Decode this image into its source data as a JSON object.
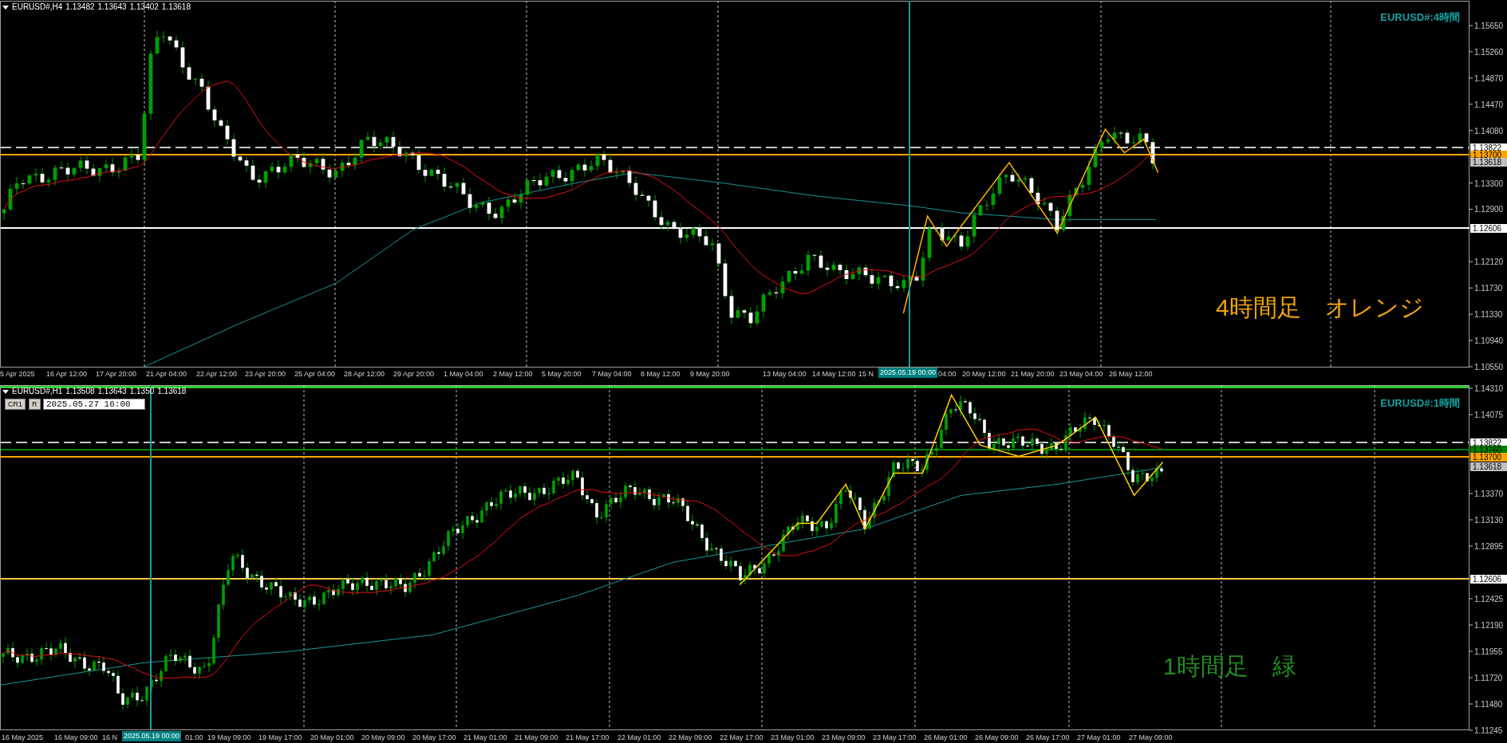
{
  "charts": [
    {
      "header": {
        "symbol": "EURUSD#,H4",
        "ohlc": [
          "1.13482",
          "1.13643",
          "1.13402",
          "1.13618"
        ]
      },
      "title": "EURUSD#:4時間",
      "note": {
        "text": "4時間足　オレンジ",
        "color": "#f0a30a"
      },
      "price_axis": [
        "1.15650",
        "1.15260",
        "1.14870",
        "1.14470",
        "1.14080",
        "1.13300",
        "1.12900",
        "1.12120",
        "1.11730",
        "1.11330",
        "1.10940",
        "1.10550"
      ],
      "price_lines": [
        {
          "kind": "dashed",
          "color": "#c8c8c8"
        },
        {
          "kind": "solid",
          "color": "#ffa500"
        },
        {
          "kind": "solid",
          "color": "#ffffff"
        }
      ],
      "price_tags": [
        {
          "text": "1.13822",
          "color": "#ffffff"
        },
        {
          "text": "1.13700",
          "color": "#ffa500"
        },
        {
          "text": "1.13618",
          "color": "#c0c0c0"
        },
        {
          "text": "1.12606",
          "color": "#ffffff"
        }
      ],
      "time_axis": [
        "5 Apr 2025",
        "16 Apr 12:00",
        "17 Apr 20:00",
        "21 Apr 04:00",
        "22 Apr 12:00",
        "23 Apr 20:00",
        "25 Apr 04:00",
        "28 Apr 12:00",
        "29 Apr 20:00",
        "1 May 04:00",
        "2 May 12:00",
        "5 May 20:00",
        "7 May 04:00",
        "8 May 12:00",
        "9 May 20:00",
        "13 May 04:00",
        "14 May 12:00",
        "15 N",
        "04:00",
        "20 May 12:00",
        "21 May 20:00",
        "23 May 04:00",
        "26 May 12:00"
      ],
      "time_cursor": "2025.05.19 00:00"
    },
    {
      "header": {
        "symbol": "EURUSD#,H1",
        "ohlc": [
          "1.13508",
          "1.13643",
          "1.1350",
          "1.13618"
        ]
      },
      "toolbar": {
        "buttons": [
          "CR1",
          "R"
        ],
        "date_field": "2025.05.27 16:00"
      },
      "title": "EURUSD#:1時間",
      "note": {
        "text": "1時間足　緑",
        "color": "#228b22"
      },
      "price_axis": [
        "1.14310",
        "1.14075",
        "1.13370",
        "1.13130",
        "1.12895",
        "1.12425",
        "1.12190",
        "1.11955",
        "1.11720",
        "1.11480",
        "1.11245"
      ],
      "price_lines": [
        {
          "kind": "dashed",
          "color": "#c8c8c8"
        },
        {
          "kind": "solid",
          "color": "#008000"
        },
        {
          "kind": "solid",
          "color": "#ffa500"
        },
        {
          "kind": "solid",
          "color": "#f5c542"
        }
      ],
      "price_tags": [
        {
          "text": "1.13822",
          "color": "#ffffff"
        },
        {
          "text": "1.13760",
          "color": "#008000"
        },
        {
          "text": "1.13700",
          "color": "#ffa500"
        },
        {
          "text": "1.13618",
          "color": "#c0c0c0"
        },
        {
          "text": "1.12606",
          "color": "#ffffff"
        }
      ],
      "time_axis": [
        "16 May 2025",
        "16 May 09:00",
        "16 N",
        "01:00",
        "19 May 09:00",
        "19 May 17:00",
        "20 May 01:00",
        "20 May 09:00",
        "20 May 17:00",
        "21 May 01:00",
        "21 May 09:00",
        "21 May 17:00",
        "22 May 01:00",
        "22 May 09:00",
        "22 May 17:00",
        "23 May 01:00",
        "23 May 09:00",
        "23 May 17:00",
        "26 May 01:00",
        "26 May 09:00",
        "26 May 17:00",
        "27 May 01:00",
        "27 May 09:00"
      ],
      "time_cursor": "2025.05.19 00:00"
    }
  ]
}
